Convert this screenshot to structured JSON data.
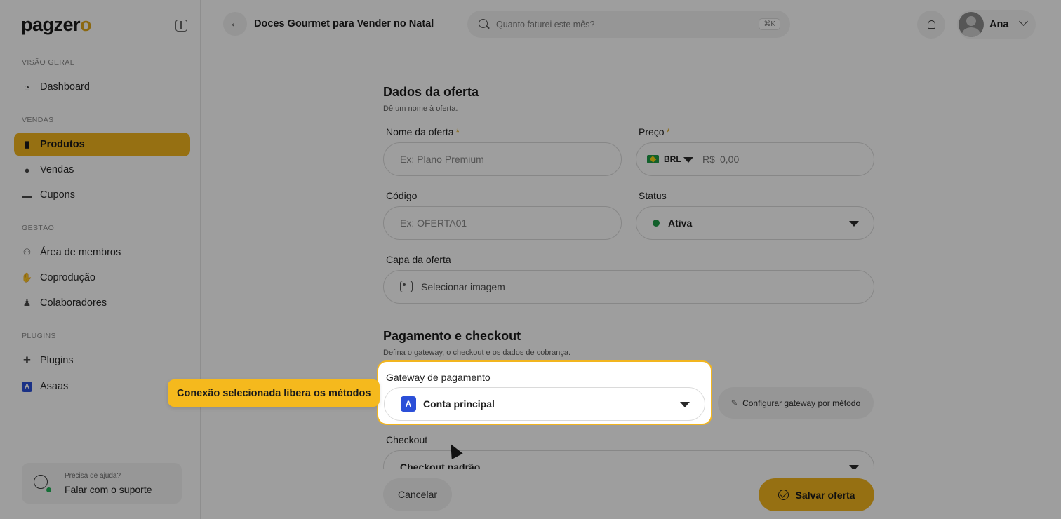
{
  "brand": {
    "logo_main": "pagzer",
    "logo_accent": "o"
  },
  "sidebar": {
    "sections": [
      {
        "label": "VISÃO GERAL"
      },
      {
        "label": "VENDAS"
      },
      {
        "label": "GESTÃO"
      },
      {
        "label": "PLUGINS"
      }
    ],
    "items": [
      {
        "label": "Dashboard",
        "icon": "dashboard-icon"
      },
      {
        "label": "Produtos",
        "icon": "products-icon",
        "active": true
      },
      {
        "label": "Vendas",
        "icon": "sales-icon"
      },
      {
        "label": "Cupons",
        "icon": "coupon-icon"
      },
      {
        "label": "Área de membros",
        "icon": "members-icon"
      },
      {
        "label": "Coprodução",
        "icon": "handshake-icon"
      },
      {
        "label": "Colaboradores",
        "icon": "user-icon"
      },
      {
        "label": "Plugins",
        "icon": "puzzle-icon"
      },
      {
        "label": "Asaas",
        "icon": "asaas-icon"
      }
    ],
    "support": {
      "small": "Precisa de ajuda?",
      "big": "Falar com o suporte"
    }
  },
  "header": {
    "title": "Doces Gourmet para Vender no Natal",
    "search_placeholder": "Quanto faturei este mês?",
    "search_shortcut": "⌘K",
    "user_name": "Ana"
  },
  "offer": {
    "title": "Dados da oferta",
    "subtitle": "Dê um nome à oferta.",
    "name_label": "Nome da oferta",
    "name_placeholder": "Ex: Plano Premium",
    "price_label": "Preço",
    "currency": "BRL",
    "currency_symbol": "R$",
    "price_placeholder": "0,00",
    "code_label": "Código",
    "code_placeholder": "Ex: OFERTA01",
    "status_label": "Status",
    "status_value": "Ativa",
    "cover_label": "Capa da oferta",
    "cover_button": "Selecionar imagem",
    "required_mark": "*"
  },
  "payment": {
    "title": "Pagamento e checkout",
    "subtitle": "Defina o gateway, o checkout e os dados de cobrança.",
    "gateway_label": "Gateway de pagamento",
    "gateway_value": "Conta principal",
    "configure_button": "Configurar gateway por método",
    "checkout_label": "Checkout",
    "checkout_value": "Checkout padrão"
  },
  "tooltip": "Conexão selecionada libera os métodos",
  "footer": {
    "cancel": "Cancelar",
    "save": "Salvar oferta"
  },
  "colors": {
    "accent": "#f2b51e",
    "status_active": "#1e9b46",
    "asaas_blue": "#2b4fd8"
  }
}
